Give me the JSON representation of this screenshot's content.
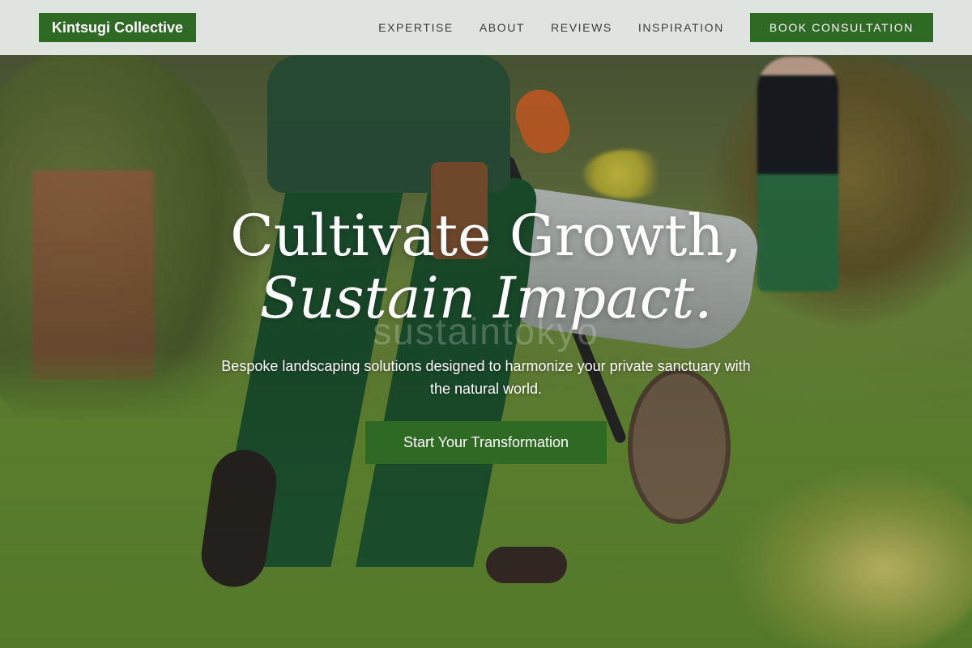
{
  "navbar": {
    "brand": "Kintsugi Collective",
    "links": [
      "EXPERTISE",
      "ABOUT",
      "REVIEWS",
      "INSPIRATION"
    ],
    "cta_label": "BOOK CONSULTATION"
  },
  "hero": {
    "headline_line1": "Cultivate Growth,",
    "headline_line2": "Sustain Impact.",
    "watermark": "sustaintokyo",
    "subtitle": "Bespoke landscaping solutions designed to harmonize your private sanctuary with the natural world.",
    "cta_label": "Start Your Transformation"
  },
  "colors": {
    "brand_green": "#2f6a25",
    "navbar_bg": "#eceeed",
    "nav_text": "#3b3b3b"
  }
}
